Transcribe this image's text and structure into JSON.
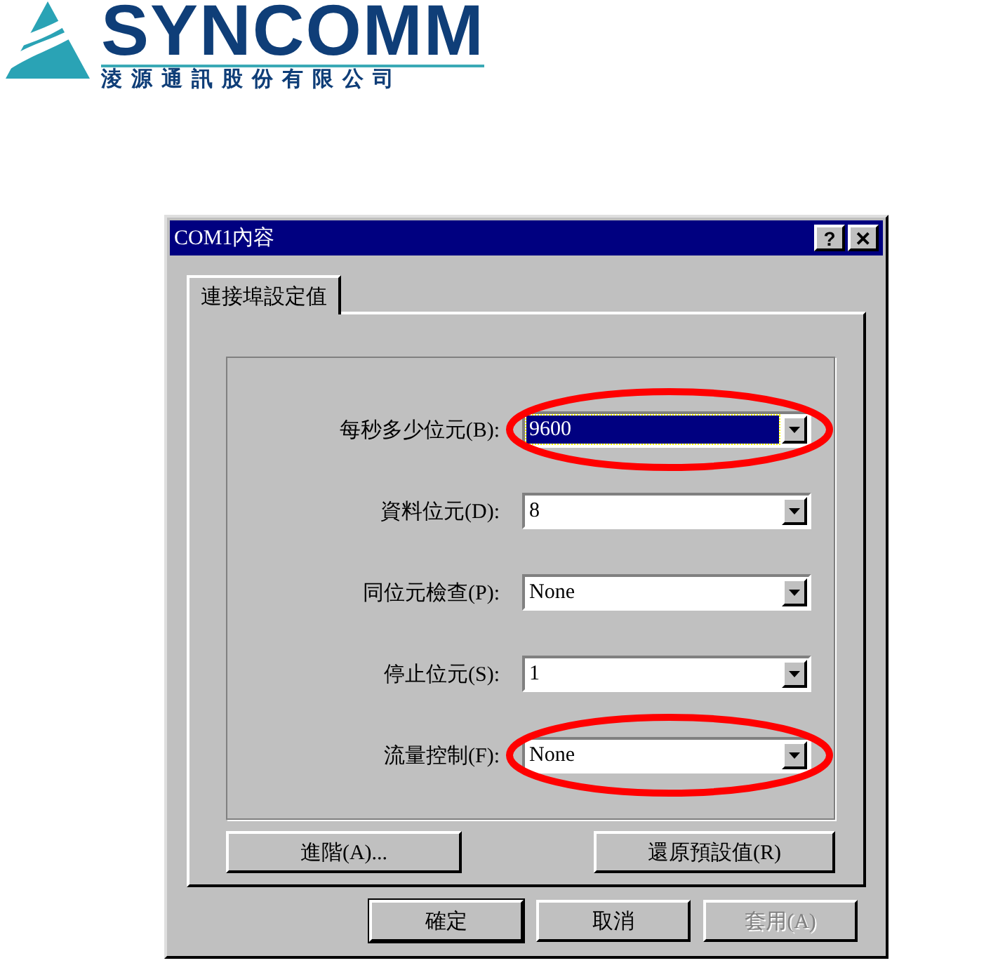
{
  "logo": {
    "name": "SYNCOMM",
    "subtitle": "淩源通訊股份有限公司"
  },
  "window": {
    "title": "COM1內容",
    "title_buttons": [
      "?",
      "✕"
    ]
  },
  "tabs": [
    {
      "label": "連接埠設定值",
      "selected": true
    }
  ],
  "fields": [
    {
      "label": "每秒多少位元(B):",
      "value": "9600",
      "focused": true,
      "highlighted": true
    },
    {
      "label": "資料位元(D):",
      "value": "8",
      "focused": false,
      "highlighted": false
    },
    {
      "label": "同位元檢查(P):",
      "value": "None",
      "focused": false,
      "highlighted": false
    },
    {
      "label": "停止位元(S):",
      "value": "1",
      "focused": false,
      "highlighted": false
    },
    {
      "label": "流量控制(F):",
      "value": "None",
      "focused": false,
      "highlighted": true
    }
  ],
  "panel_buttons": [
    "進階(A)...",
    "還原預設值(R)"
  ],
  "dialog_buttons": [
    {
      "label": "確定",
      "default": true,
      "disabled": false
    },
    {
      "label": "取消",
      "default": false,
      "disabled": false
    },
    {
      "label": "套用(A)",
      "default": false,
      "disabled": true
    }
  ]
}
